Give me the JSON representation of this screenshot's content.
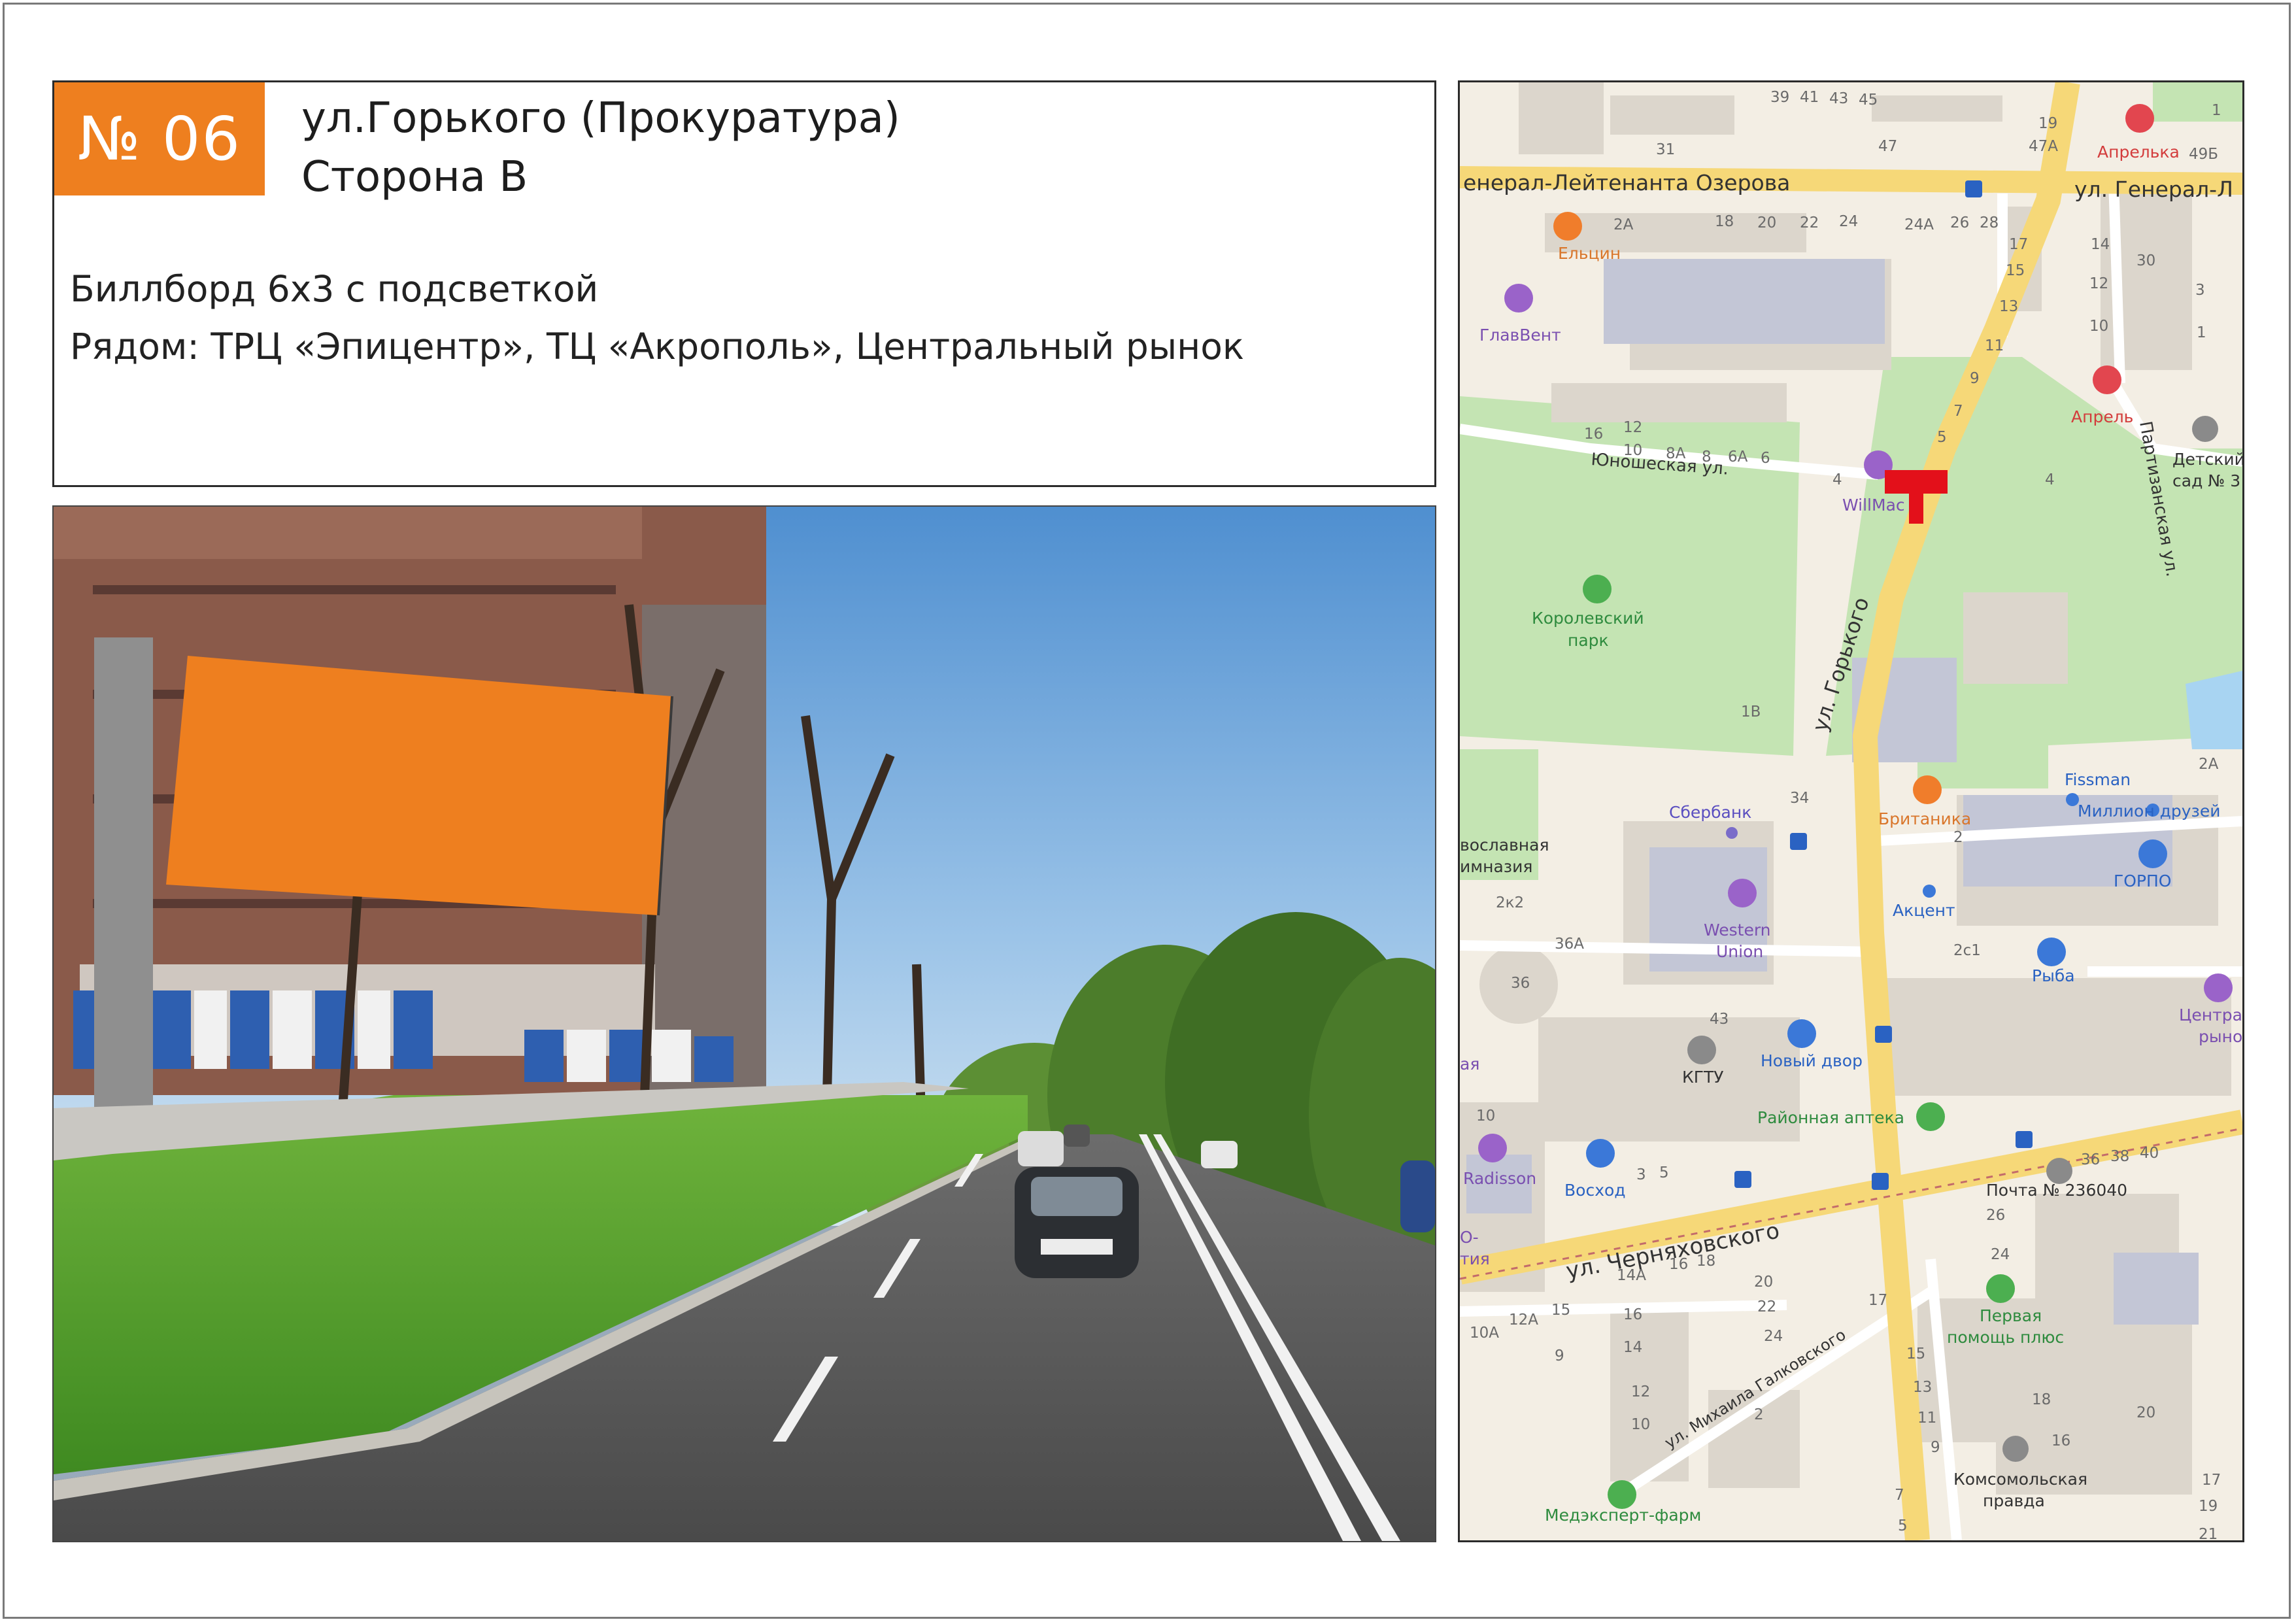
{
  "badge": {
    "number": "№ 06",
    "color": "#ee7f1f"
  },
  "title": {
    "line1": "ул.Горького (Прокуратура)",
    "line2": "Сторона В"
  },
  "description": {
    "line1": "Биллборд 6х3 с подсветкой",
    "line2": "Рядом: ТРЦ «Эпицентр», ТЦ «Акрополь», Центральный рынок"
  },
  "photo": {
    "billboard_color": "#ee7f1f"
  },
  "map": {
    "marker_color": "#e3101a",
    "streets": {
      "ozerova": "енерал-Лейтенанта Озерова",
      "ozerova_right": "ул. Генерал-Л",
      "yunosheskaya": "Юношеская ул.",
      "gorkogo": "ул. Горького",
      "partizanskaya": "Партизанская ул.",
      "chernyakhovskogo": "ул. Черняховского",
      "galkovskogo": "ул. Михаила Галковского"
    },
    "places": {
      "aprelka": "Апрелька",
      "elcin": "Ельцин",
      "glavvent": "ГлавВент",
      "aprel": "Апрель",
      "detsky": "Детский",
      "detsky2": "сад № 3",
      "willmac": "WillMac",
      "korol1": "Королевский",
      "korol2": "парк",
      "sberbank": "Сбербанк",
      "britanika": "Британика",
      "fissman": "Fissman",
      "million": "Миллион друзей",
      "gorpo": "ГОРПО",
      "akcent": "Акцент",
      "western1": "Western",
      "western2": "Union",
      "pravoslav1": "вославная",
      "pravoslav2": "имназия",
      "ryba": "Рыба",
      "central1": "Централь",
      "central2": "рынок",
      "kgtu": "КГТУ",
      "novy_dvor": "Новый двор",
      "rayonnaya": "Районная аптека",
      "radisson": "Radisson",
      "voskhod": "Восход",
      "pochta": "Почта № 236040",
      "pervaya1": "Первая",
      "pervaya2": "помощь плюс",
      "komsomol1": "Комсомольская",
      "komsomol2": "правда",
      "medexpert": "Медэксперт-фарм",
      "edge_ya": "ая",
      "edge_o": "О-",
      "edge_tiya": "тия"
    },
    "house_numbers": {
      "n39": "39",
      "n41": "41",
      "n43": "43",
      "n45": "45",
      "n19": "19",
      "n1a": "1",
      "n31": "31",
      "n47": "47",
      "n47a": "47А",
      "n49b": "49Б",
      "n2a": "2А",
      "n18": "18",
      "n20": "20",
      "n22": "22",
      "n24": "24",
      "n24a": "24А",
      "n26": "26",
      "n28": "28",
      "n17": "17",
      "n15": "15",
      "n13": "13",
      "n11": "11",
      "n9": "9",
      "n7": "7",
      "n5": "5",
      "n14": "14",
      "n30": "30",
      "n12": "12",
      "n3": "3",
      "n10": "10",
      "n1b": "1",
      "n16": "16",
      "n12b": "12",
      "n10b": "10",
      "n8a": "8А",
      "n8": "8",
      "n6a": "6А",
      "n6": "6",
      "n4": "4",
      "n4b": "4",
      "n1v": "1В",
      "n2a2": "2А",
      "n34": "34",
      "n2": "2",
      "n2k2": "2к2",
      "n36a": "36А",
      "n36": "36",
      "n2c1": "2с1",
      "n43b": "43",
      "n10c": "10",
      "n3c": "3",
      "n5c": "5",
      "n36c": "36",
      "n38": "38",
      "n40": "40",
      "n26c": "26",
      "n24c": "24",
      "n14a": "14А",
      "n16c": "16",
      "n18c": "18",
      "n20c": "20",
      "n22c": "22",
      "n24d": "24",
      "n17c": "17",
      "n10a": "10А",
      "n12a": "12А",
      "n15c": "15",
      "n9c": "9",
      "n16d": "16",
      "n14c": "14",
      "n12c": "12",
      "n10d": "10",
      "n2d": "2",
      "n15d": "15",
      "n13c": "13",
      "n11c": "11",
      "n9d": "9",
      "n18d": "18",
      "n20d": "20",
      "n16e": "16",
      "n7c": "7",
      "n5d": "5",
      "n17d": "17",
      "n19d": "19",
      "n21": "21"
    }
  }
}
